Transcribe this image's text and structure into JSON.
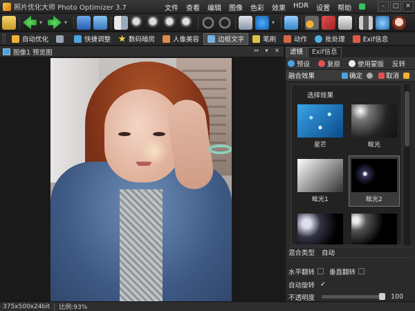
{
  "window": {
    "title": "照片优化大师 Photo Optimizer 3.7",
    "minimize": "–",
    "maximize": "□",
    "close": "✕"
  },
  "menu": [
    "文件",
    "查看",
    "编辑",
    "图像",
    "色彩",
    "效果",
    "HDR",
    "设置",
    "帮助"
  ],
  "tabs": [
    {
      "label": "自动优化",
      "icon": "magic-wand-icon",
      "color": "#f2b134"
    },
    {
      "label": "",
      "icon": "tools-icon",
      "color": "#9aa4b0"
    },
    {
      "label": "快捷调整",
      "icon": "quick-adjust-icon",
      "color": "#4aa5e0"
    },
    {
      "label": "数码暗房",
      "icon": "star-icon",
      "color": "#f6d24a"
    },
    {
      "label": "人像美容",
      "icon": "portrait-icon",
      "color": "#e08a4a"
    },
    {
      "label": "边框文字",
      "icon": "frame-icon",
      "color": "#7ab0e0",
      "active": true
    },
    {
      "label": "笔刷",
      "icon": "brush-icon",
      "color": "#e0c24a"
    },
    {
      "label": "动作",
      "icon": "action-icon",
      "color": "#d06a4a"
    },
    {
      "label": "批处理",
      "icon": "batch-icon",
      "color": "#4ab0e0"
    },
    {
      "label": "Exif信息",
      "icon": "exif-icon",
      "color": "#e05a4a"
    }
  ],
  "preview": {
    "title": "图像1 预览图"
  },
  "right_panel": {
    "tabs": [
      "滤镜",
      "Exif信息"
    ],
    "actions": [
      "预设",
      "复原",
      "使用蒙版",
      "反转"
    ],
    "section_title": "融合效果",
    "confirm": "确定",
    "cancel": "取消",
    "effects_label": "选择效果",
    "effects": [
      "星芒",
      "眩光",
      "眩光1",
      "眩光2"
    ],
    "blend_label": "混合类型",
    "blend_value": "自动",
    "flip_h": "水平翻转",
    "flip_v": "垂直翻转",
    "auto_rotate": "自动旋转",
    "auto_rotate_check": "✓",
    "opacity_label": "不透明度",
    "opacity_value": "100"
  },
  "status": {
    "size": "375x500x24bit",
    "zoom": "比例:93%"
  }
}
